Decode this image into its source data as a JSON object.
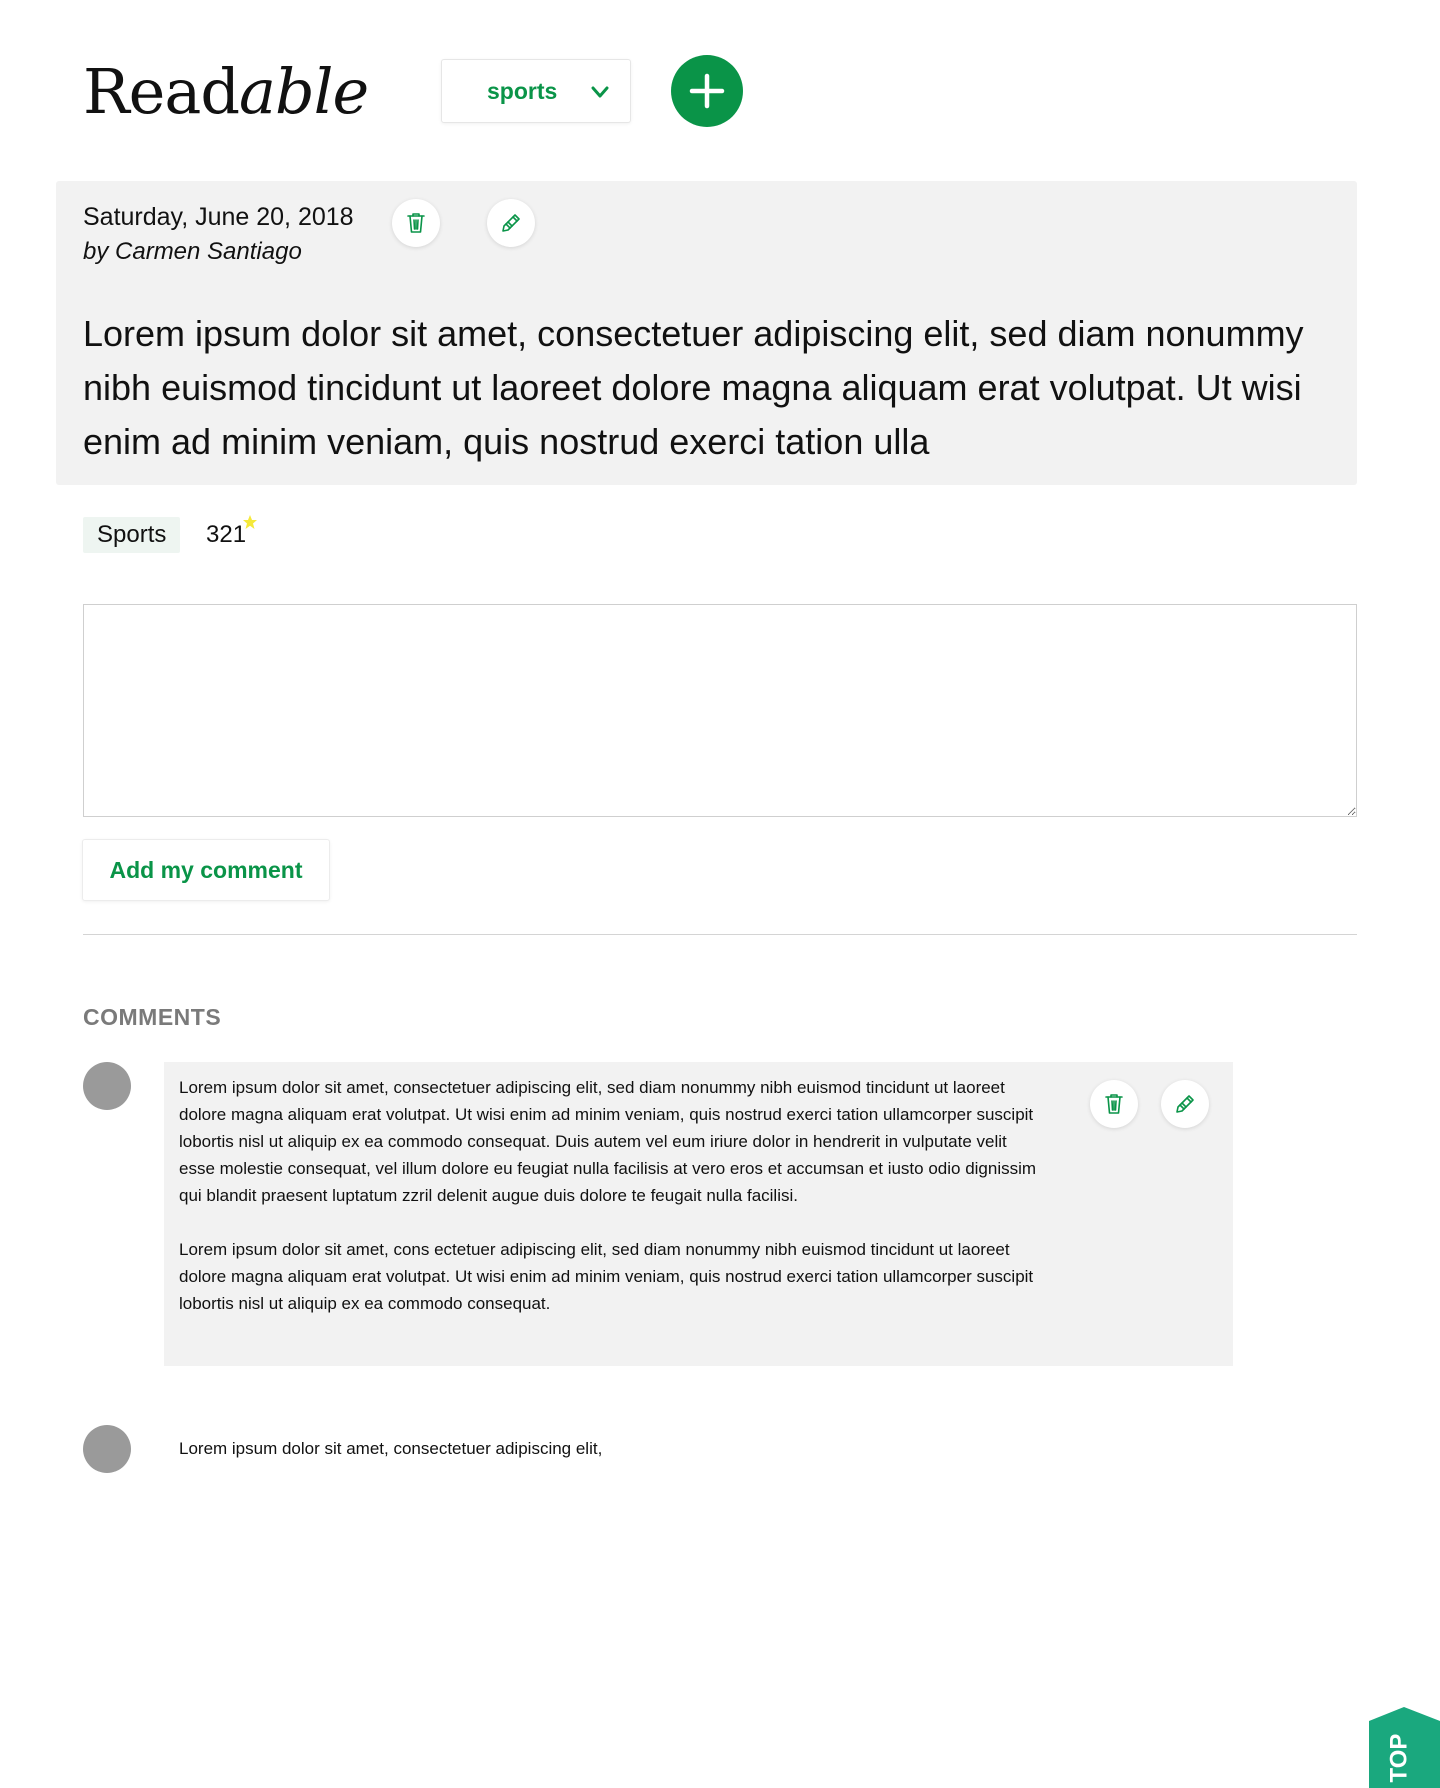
{
  "header": {
    "logo_regular": "Read",
    "logo_italic": "able",
    "category_value": "sports",
    "add_post_icon": "plus-icon"
  },
  "post": {
    "date": "Saturday, June 20, 2018",
    "author": "by Carmen Santiago",
    "body": "Lorem ipsum dolor sit amet, consectetuer adipiscing elit, sed diam nonummy nibh euismod tincidunt ut laoreet dolore magna aliquam erat volutpat. Ut wisi enim ad minim veniam, quis nostrud exerci tation ulla",
    "category_tag": "Sports",
    "score": "321",
    "delete_icon": "trash-icon",
    "edit_icon": "pencil-icon"
  },
  "comment_form": {
    "input_value": "",
    "submit_label": "Add my comment"
  },
  "comments": {
    "heading": "COMMENTS",
    "items": [
      {
        "paragraph1": "Lorem ipsum dolor sit amet, consectetuer adipiscing elit, sed diam nonummy nibh euismod tincidunt ut laoreet dolore magna aliquam erat volutpat. Ut wisi enim ad minim veniam, quis nostrud exerci tation ullam­corper suscipit lobortis nisl ut aliquip ex ea commodo consequat. Duis autem vel eum iriure dolor in hendre­rit in vulputate velit esse molestie consequat, vel illum dolore eu feugiat nulla facilisis at vero eros et ac­cumsan et iusto odio dignissim qui blandit praesent luptatum zzril delenit augue duis dolore te feugait nulla facilisi.",
        "paragraph2": "Lorem ipsum dolor sit amet, cons ectetuer adipiscing elit, sed diam nonummy nibh euismod tincidunt ut laoreet dolore magna aliquam erat volutpat. Ut wisi enim ad minim veniam, quis nostrud exerci tation ullam­corper suscipit lobortis nisl ut aliquip ex ea commodo consequat."
      },
      {
        "paragraph1": "Lorem ipsum dolor sit amet, consectetuer adipiscing elit,"
      }
    ]
  },
  "back_to_top": {
    "label": "TOP"
  },
  "colors": {
    "accent": "#0a9448",
    "panel": "#f2f2f2",
    "top_button": "#1aa87e",
    "avatar": "#9a9a9a",
    "star": "#f5e93a"
  }
}
